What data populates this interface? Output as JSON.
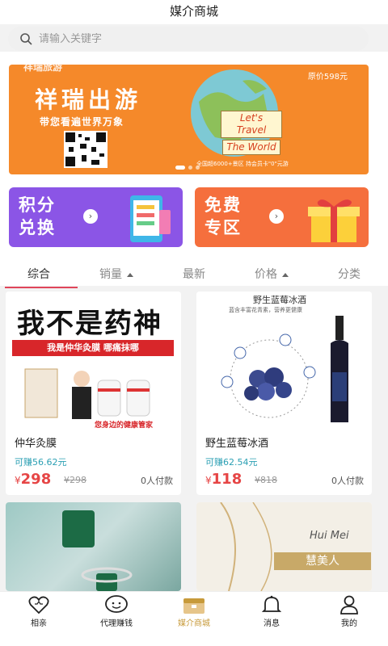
{
  "header": {
    "title": "媒介商城"
  },
  "search": {
    "placeholder": "请输入关键字"
  },
  "banner": {
    "logo_text": "祥瑞旅游",
    "title": "祥瑞出游",
    "subtitle": "带您看遍世界万象",
    "price_tag": "原价598元",
    "travel_line1": "Let's Travel",
    "travel_line2": "The World",
    "fine_print": "全国超6000+景区 持会员卡\"0\"元游"
  },
  "tiles": [
    {
      "line1": "积分",
      "line2": "兑换",
      "color": "#8b55e6"
    },
    {
      "line1": "免费",
      "line2": "专区",
      "color": "#f56f3d"
    }
  ],
  "tabs": [
    "综合",
    "销量",
    "最新",
    "价格",
    "分类"
  ],
  "products": [
    {
      "name": "仲华灸膜",
      "earn": "可赚56.62元",
      "currency": "¥",
      "price": "298",
      "old_price": "¥298",
      "paid": "0人付款",
      "img_head": "我不是药神",
      "img_sub": "我是仲华灸膜 哪痛抹哪",
      "img_caption": "您身边的健康管家"
    },
    {
      "name": "野生蓝莓冰酒",
      "earn": "可赚62.54元",
      "currency": "¥",
      "price": "118",
      "old_price": "¥818",
      "paid": "0人付款",
      "img_head": "野生蓝莓冰酒",
      "img_sub": "蓝含丰富花青素，营养更健康"
    },
    {
      "name": "",
      "img_head": ""
    },
    {
      "name": "",
      "img_head": "慧美人",
      "img_sub": "Hui Mei"
    }
  ],
  "nav": [
    {
      "label": "相亲",
      "icon": "heart-icon"
    },
    {
      "label": "代理赚钱",
      "icon": "chat-smile-icon"
    },
    {
      "label": "媒介商城",
      "icon": "shop-box-icon",
      "active": true
    },
    {
      "label": "消息",
      "icon": "bell-icon"
    },
    {
      "label": "我的",
      "icon": "user-icon"
    }
  ],
  "colors": {
    "accent": "#e64545",
    "earn": "#2a9fb3",
    "nav_active": "#c79a3a",
    "banner": "#f5892a"
  }
}
